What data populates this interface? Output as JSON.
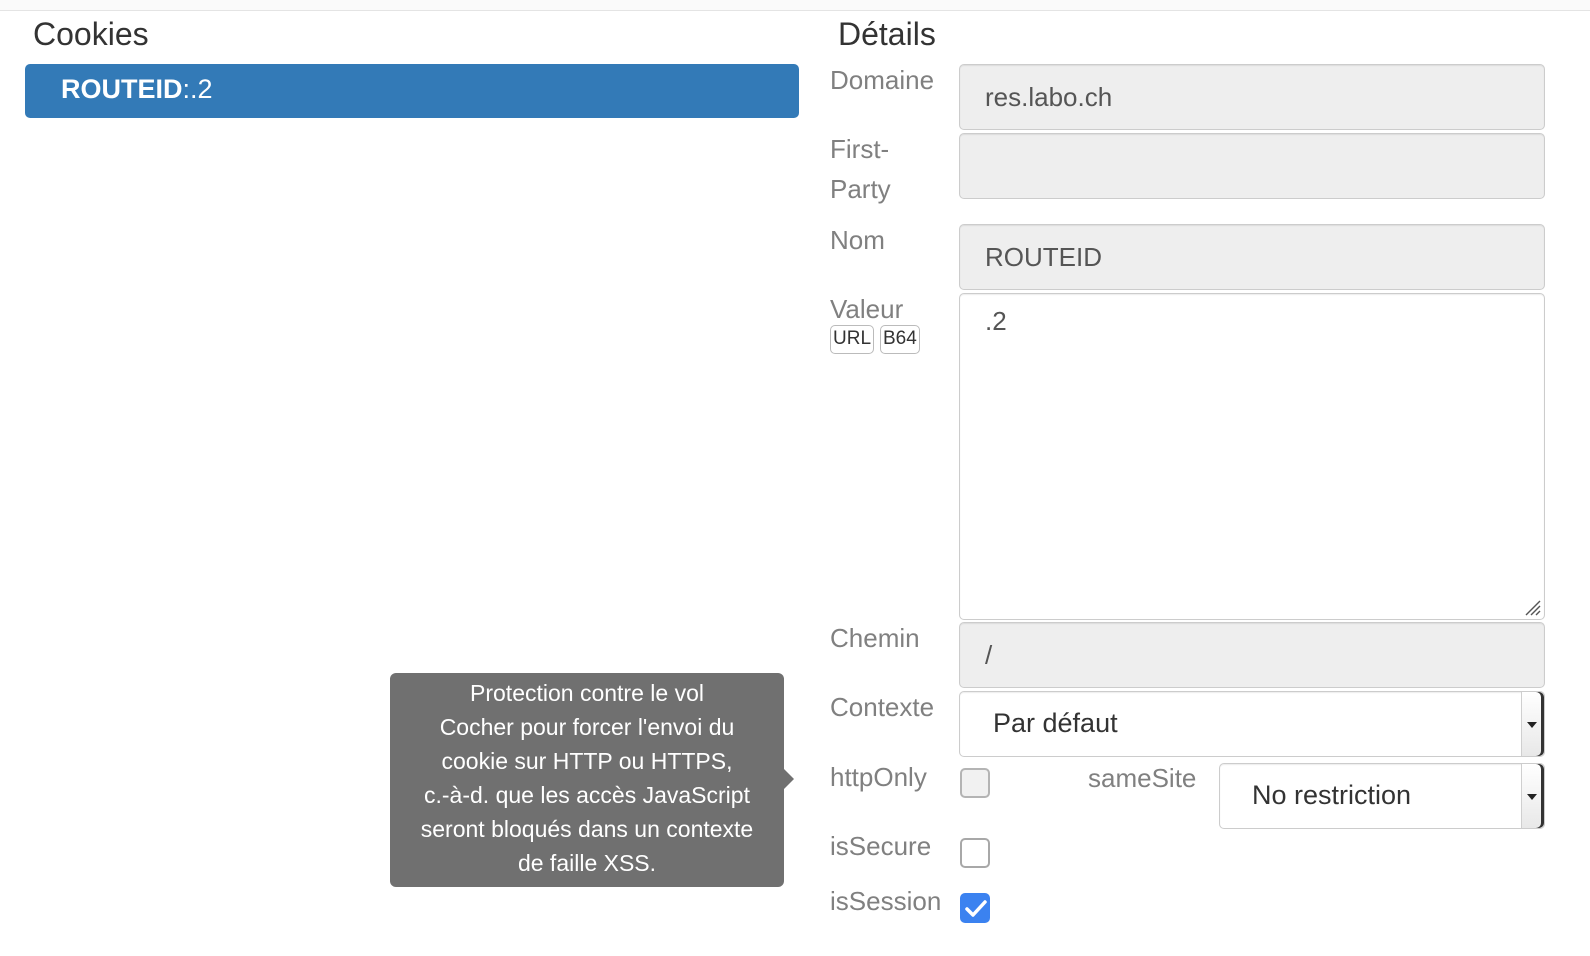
{
  "panels": {
    "cookies_title": "Cookies",
    "details_title": "Détails"
  },
  "cookie_list": [
    {
      "name": "ROUTEID",
      "separator": ":",
      "value": ".2",
      "selected": true
    }
  ],
  "details": {
    "domain": {
      "label": "Domaine",
      "value": "res.labo.ch"
    },
    "first_party": {
      "label_line1": "First-",
      "label_line2": "Party",
      "value": ""
    },
    "name": {
      "label": "Nom",
      "value": "ROUTEID"
    },
    "value": {
      "label": "Valeur",
      "value": ".2",
      "url_button": "URL",
      "b64_button": "B64"
    },
    "path": {
      "label": "Chemin",
      "value": "/"
    },
    "context": {
      "label": "Contexte",
      "selected": "Par défaut"
    },
    "http_only": {
      "label": "httpOnly",
      "checked": false
    },
    "same_site": {
      "label": "sameSite",
      "selected": "No restriction"
    },
    "is_secure": {
      "label": "isSecure",
      "checked": false
    },
    "is_session": {
      "label": "isSession",
      "checked": true
    }
  },
  "tooltip": {
    "lines": [
      "Protection contre le vol",
      "Cocher pour forcer l'envoi du",
      "cookie sur HTTP ou HTTPS,",
      "c.-à-d. que les accès JavaScript",
      "seront bloqués dans un contexte",
      "de faille XSS."
    ]
  },
  "colors": {
    "selected_item": "#337ab7",
    "checkbox_checked": "#3b82f0",
    "tooltip_bg": "#707070"
  }
}
